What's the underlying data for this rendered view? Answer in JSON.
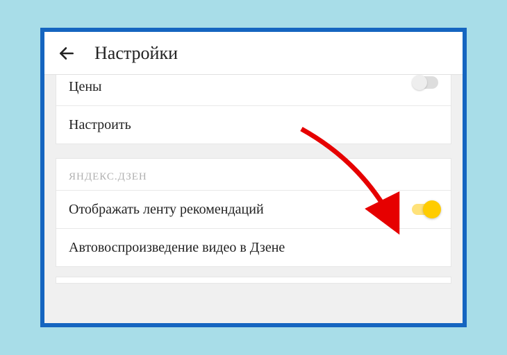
{
  "header": {
    "title": "Настройки"
  },
  "section1": {
    "row_prices": "Цены",
    "row_configure": "Настроить"
  },
  "section2": {
    "header": "ЯНДЕКС.ДЗЕН",
    "row_feed": "Отображать ленту рекомендаций",
    "row_autoplay": "Автовоспроизведение видео в Дзене"
  }
}
